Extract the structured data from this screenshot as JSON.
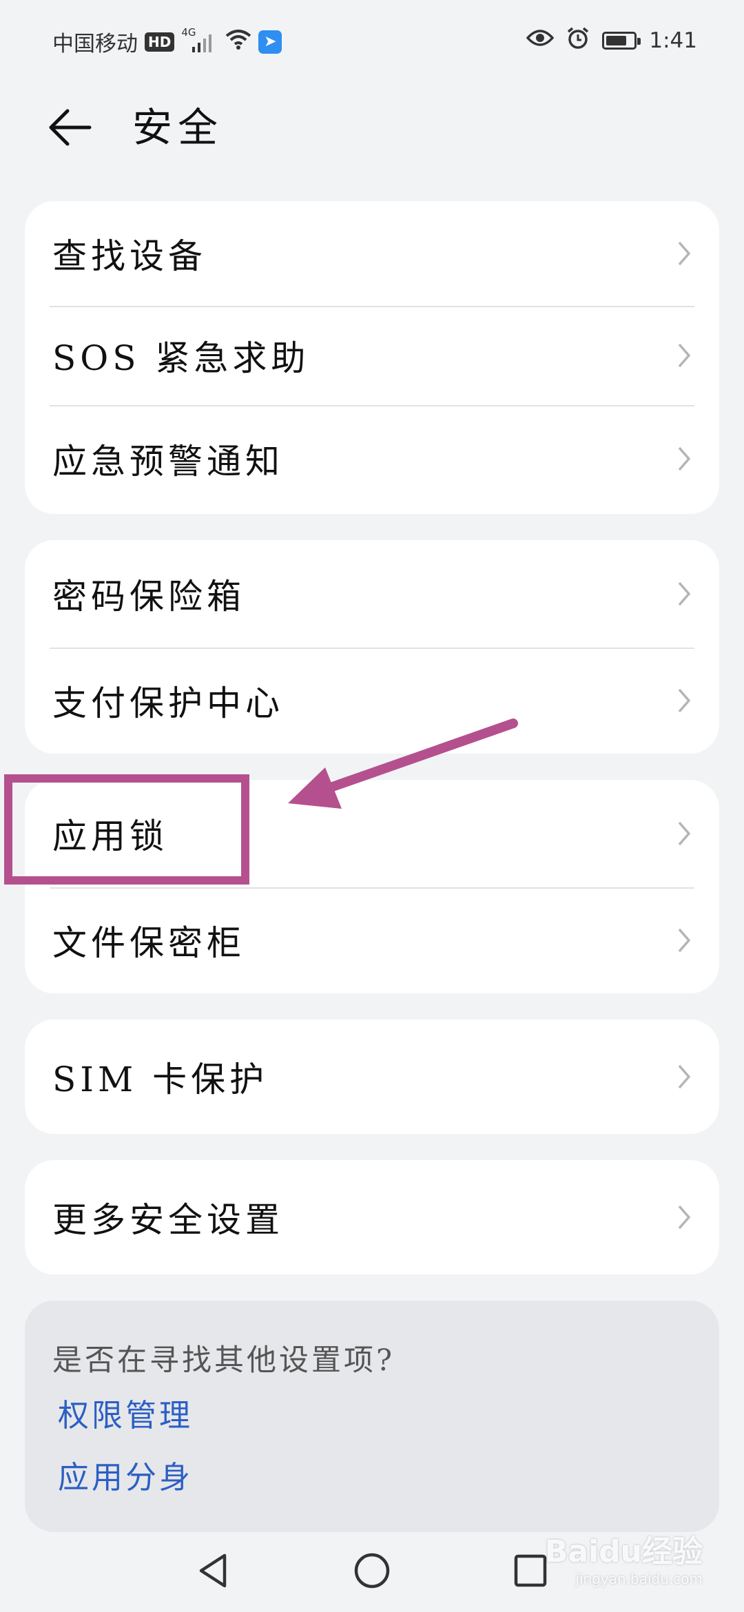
{
  "status_bar": {
    "carrier": "中国移动",
    "hd": "HD",
    "network": "4G",
    "time": "1:41",
    "battery_level": 0.75
  },
  "header": {
    "title": "安全",
    "back_icon": "arrow-left-icon"
  },
  "groups": [
    {
      "items": [
        {
          "label": "查找设备"
        },
        {
          "label": "SOS 紧急求助"
        },
        {
          "label": "应急预警通知"
        }
      ]
    },
    {
      "items": [
        {
          "label": "密码保险箱"
        },
        {
          "label": "支付保护中心"
        }
      ]
    },
    {
      "items": [
        {
          "label": "应用锁"
        },
        {
          "label": "文件保密柜"
        }
      ]
    },
    {
      "items": [
        {
          "label": "SIM 卡保护"
        }
      ]
    },
    {
      "items": [
        {
          "label": "更多安全设置"
        }
      ]
    }
  ],
  "search_other": {
    "question": "是否在寻找其他设置项?",
    "links": [
      "权限管理",
      "应用分身"
    ]
  },
  "nav_bar": {
    "back": "triangle-back-icon",
    "home": "circle-home-icon",
    "recent": "square-recent-icon"
  },
  "annotation": {
    "color": "#b5508f"
  },
  "watermark": {
    "main": "Baidu经验",
    "sub": "jingyan.baidu.com"
  }
}
